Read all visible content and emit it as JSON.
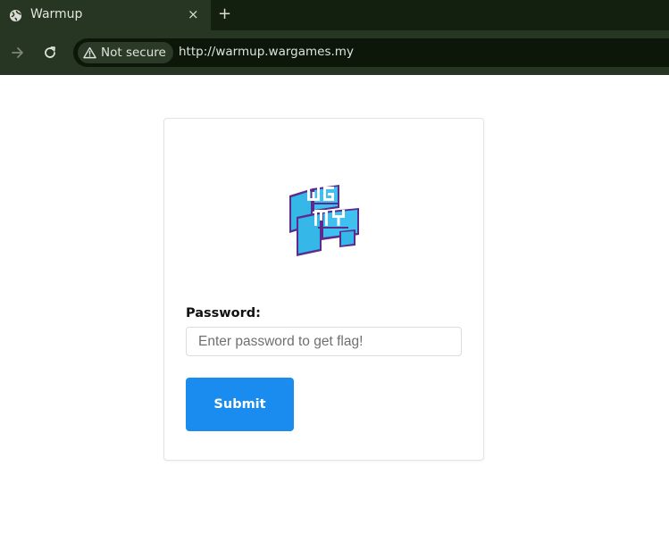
{
  "browser": {
    "tab_title": "Warmup",
    "tab_close": "×",
    "new_tab": "+",
    "security_chip": "Not secure",
    "url": "http://warmup.wargames.my"
  },
  "form": {
    "password_label": "Password:",
    "password_placeholder": "Enter password to get flag!",
    "password_value": "",
    "submit_label": "Submit"
  },
  "logo": {
    "text_line1": "WG",
    "text_line2": "MY"
  },
  "colors": {
    "submit_bg": "#1a8cf0",
    "chrome_bg": "#263622",
    "logo_cyan": "#35b7e8",
    "logo_purple": "#5b2b8e"
  },
  "icons": {
    "tab": "globe-icon",
    "forward": "arrow-right-icon",
    "reload": "reload-icon",
    "security": "warning-triangle-icon"
  }
}
